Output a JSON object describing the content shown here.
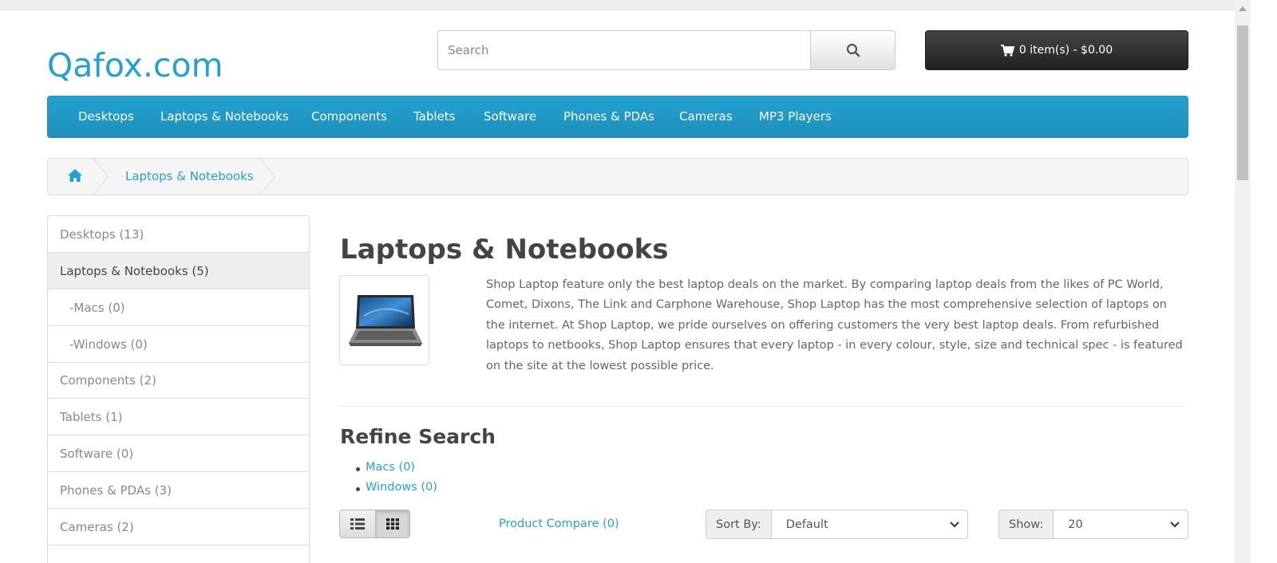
{
  "header": {
    "logo_text": "Qafox.com",
    "search": {
      "placeholder": "Search",
      "value": ""
    },
    "cart": {
      "label": "0 item(s) - $0.00"
    }
  },
  "menu": {
    "items": [
      {
        "label": "Desktops"
      },
      {
        "label": "Laptops & Notebooks"
      },
      {
        "label": "Components"
      },
      {
        "label": "Tablets"
      },
      {
        "label": "Software"
      },
      {
        "label": "Phones & PDAs"
      },
      {
        "label": "Cameras"
      },
      {
        "label": "MP3 Players"
      }
    ]
  },
  "breadcrumb": {
    "items": [
      {
        "label": "Laptops & Notebooks"
      }
    ]
  },
  "sidebar": {
    "items": [
      {
        "label": "Desktops (13)",
        "active": false,
        "sub": false
      },
      {
        "label": "Laptops & Notebooks (5)",
        "active": true,
        "sub": false
      },
      {
        "label": "-Macs (0)",
        "active": false,
        "sub": true
      },
      {
        "label": "-Windows (0)",
        "active": false,
        "sub": true
      },
      {
        "label": "Components (2)",
        "active": false,
        "sub": false
      },
      {
        "label": "Tablets (1)",
        "active": false,
        "sub": false
      },
      {
        "label": "Software (0)",
        "active": false,
        "sub": false
      },
      {
        "label": "Phones & PDAs (3)",
        "active": false,
        "sub": false
      },
      {
        "label": "Cameras (2)",
        "active": false,
        "sub": false
      }
    ]
  },
  "category": {
    "title": "Laptops & Notebooks",
    "description": "Shop Laptop feature only the best laptop deals on the market. By comparing laptop deals from the likes of PC World, Comet, Dixons, The Link and Carphone Warehouse, Shop Laptop has the most comprehensive selection of laptops on the internet. At Shop Laptop, we pride ourselves on offering customers the very best laptop deals. From refurbished laptops to netbooks, Shop Laptop ensures that every laptop - in every colour, style, size and technical spec - is featured on the site at the lowest possible price."
  },
  "refine": {
    "title": "Refine Search",
    "items": [
      {
        "label": "Macs (0)"
      },
      {
        "label": "Windows (0)"
      }
    ]
  },
  "toolbar": {
    "view_mode": "grid",
    "compare_label": "Product Compare (0)",
    "sort_label": "Sort By:",
    "sort_value": "Default",
    "show_label": "Show:",
    "show_value": "20"
  },
  "colors": {
    "accent": "#23a1d1",
    "menu_bg": "#229ac8",
    "cart_bg": "#363636"
  }
}
